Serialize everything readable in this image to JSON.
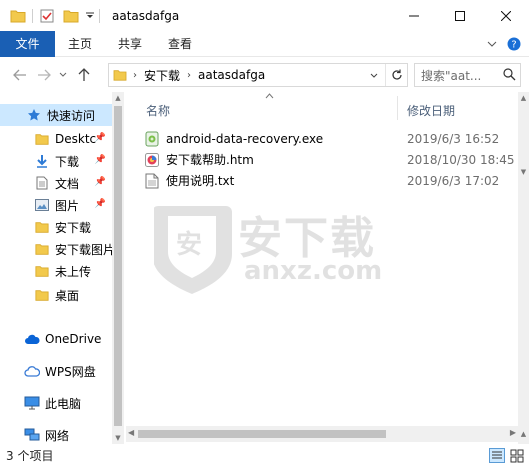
{
  "window": {
    "title": "aatasdafga",
    "minimize_glyph": "—",
    "maximize_glyph": "☐",
    "close_glyph": "✕"
  },
  "ribbon": {
    "tabs": [
      {
        "label": "文件"
      },
      {
        "label": "主页"
      },
      {
        "label": "共享"
      },
      {
        "label": "查看"
      }
    ]
  },
  "address": {
    "segments": [
      "安下载",
      "aatasdafga"
    ],
    "search_placeholder": "搜索\"aat..."
  },
  "nav": {
    "quick_access": "快速访问",
    "items": [
      {
        "label": "Desktc",
        "icon": "folder-icon",
        "pinned": true
      },
      {
        "label": "下载",
        "icon": "download-arrow-icon",
        "pinned": true
      },
      {
        "label": "文档",
        "icon": "document-icon",
        "pinned": true
      },
      {
        "label": "图片",
        "icon": "picture-icon",
        "pinned": true
      },
      {
        "label": "安下载",
        "icon": "folder-icon",
        "pinned": false
      },
      {
        "label": "安下载图片",
        "icon": "folder-icon",
        "pinned": false
      },
      {
        "label": "未上传",
        "icon": "folder-icon",
        "pinned": false
      },
      {
        "label": "桌面",
        "icon": "folder-icon",
        "pinned": false
      }
    ],
    "onedrive": "OneDrive",
    "wps": "WPS网盘",
    "this_pc": "此电脑",
    "network": "网络"
  },
  "columns": {
    "name": "名称",
    "modified": "修改日期"
  },
  "files": [
    {
      "name": "android-data-recovery.exe",
      "date": "2019/6/3 16:52",
      "icon": "exe-icon"
    },
    {
      "name": "安下载帮助.htm",
      "date": "2018/10/30 18:45",
      "icon": "htm-icon"
    },
    {
      "name": "使用说明.txt",
      "date": "2019/6/3 17:02",
      "icon": "txt-icon"
    }
  ],
  "status": {
    "count": "3 个项目"
  },
  "watermark": {
    "brand": "安下载",
    "domain": "anxz.com",
    "badge": "安"
  },
  "colors": {
    "accent": "#1a5fb4",
    "selection": "#cce8ff",
    "folder": "#f2c94c"
  }
}
